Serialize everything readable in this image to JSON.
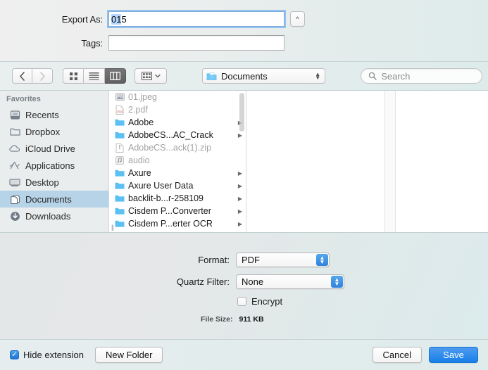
{
  "top": {
    "export_as_label": "Export As:",
    "export_as_value_selected": "01",
    "export_as_value_rest": " 5",
    "tags_label": "Tags:",
    "tags_value": "",
    "tags_placeholder": "",
    "disclosure_icon": "chevron-up-icon"
  },
  "toolbar": {
    "back_icon": "chevron-left-icon",
    "forward_icon": "chevron-right-icon",
    "view_icon_label": "icon-view-icon",
    "view_list_label": "list-view-icon",
    "view_column_label": "column-view-icon",
    "arrange_icon": "arrange-grid-icon",
    "arrange_chevron": "chevron-down-icon",
    "location_value": "Documents",
    "location_icon": "folder-documents-icon",
    "search_placeholder": "Search",
    "search_icon": "search-icon",
    "active_view": "column"
  },
  "sidebar": {
    "header": "Favorites",
    "items": [
      {
        "label": "Recents",
        "icon": "recents-icon",
        "selected": false
      },
      {
        "label": "Dropbox",
        "icon": "folder-icon",
        "selected": false
      },
      {
        "label": "iCloud Drive",
        "icon": "cloud-icon",
        "selected": false
      },
      {
        "label": "Applications",
        "icon": "applications-icon",
        "selected": false
      },
      {
        "label": "Desktop",
        "icon": "desktop-icon",
        "selected": false
      },
      {
        "label": "Documents",
        "icon": "documents-icon",
        "selected": true
      },
      {
        "label": "Downloads",
        "icon": "downloads-icon",
        "selected": false
      }
    ]
  },
  "files": [
    {
      "name": "01.jpeg",
      "icon": "image-file-icon",
      "dim": true,
      "arrow": false
    },
    {
      "name": "2.pdf",
      "icon": "pdf-file-icon",
      "dim": true,
      "arrow": false
    },
    {
      "name": "Adobe",
      "icon": "folder-icon",
      "dim": false,
      "arrow": true
    },
    {
      "name": "AdobeCS...AC_Crack",
      "icon": "folder-icon",
      "dim": false,
      "arrow": true
    },
    {
      "name": "AdobeCS...ack(1).zip",
      "icon": "zip-file-icon",
      "dim": true,
      "arrow": false
    },
    {
      "name": "audio",
      "icon": "audio-file-icon",
      "dim": true,
      "arrow": false
    },
    {
      "name": "Axure",
      "icon": "folder-icon",
      "dim": false,
      "arrow": true
    },
    {
      "name": "Axure User Data",
      "icon": "folder-icon",
      "dim": false,
      "arrow": true
    },
    {
      "name": "backlit-b...r-258109",
      "icon": "folder-icon",
      "dim": false,
      "arrow": true
    },
    {
      "name": "Cisdem P...Converter",
      "icon": "folder-icon",
      "dim": false,
      "arrow": true
    },
    {
      "name": "Cisdem P...erter OCR",
      "icon": "folder-icon",
      "dim": false,
      "arrow": true
    }
  ],
  "options": {
    "format_label": "Format:",
    "format_value": "PDF",
    "quartz_label": "Quartz Filter:",
    "quartz_value": "None",
    "encrypt_label": "Encrypt",
    "encrypt_checked": false,
    "filesize_label": "File Size:",
    "filesize_value": "911 KB"
  },
  "bottom": {
    "hide_extension_label": "Hide extension",
    "hide_extension_checked": true,
    "new_folder_label": "New Folder",
    "cancel_label": "Cancel",
    "save_label": "Save"
  },
  "colors": {
    "accent_blue": "#187fe8",
    "selection_blue": "#b6d3e8",
    "text_selection": "#b4d5fe",
    "folder_blue": "#5cc0f2",
    "window_bg": "#dfeaea"
  }
}
